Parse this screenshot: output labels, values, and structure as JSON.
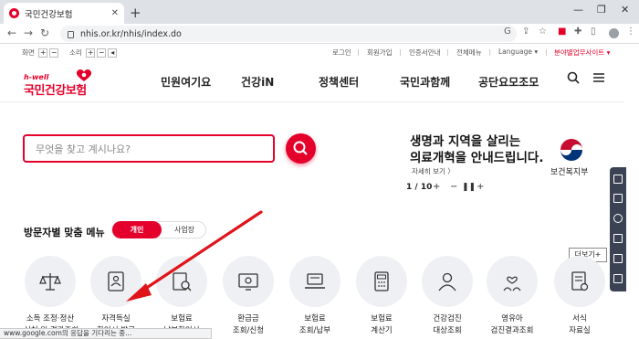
{
  "browser": {
    "tab_title": "국민건강보험",
    "tab_close": "✕",
    "new_tab": "+",
    "url": "nhis.or.kr/nhis/index.do",
    "minimize": "—",
    "restore": "❐",
    "close": "✕"
  },
  "util": {
    "zoom_label": "화면",
    "sound_label": "소리",
    "links": [
      "로그인",
      "회원가입",
      "인증서안내",
      "전체메뉴"
    ],
    "language": "Language ▾",
    "sites": "분야별업무사이트 ▾"
  },
  "logo": {
    "sub": "h-well",
    "main": "국민건강보험"
  },
  "gnb": [
    "민원여기요",
    "건강iN",
    "정책센터",
    "국민과함께",
    "공단요모조모"
  ],
  "search": {
    "placeholder": "무엇을 찾고 계시나요?"
  },
  "banner": {
    "line1": "생명과 지역을 살리는",
    "line2": "의료개혁을 안내드립니다.",
    "more": "자세히 보기 〉",
    "ministry": "보건복지부",
    "page": "1 / 10"
  },
  "section": {
    "title": "방문자별 맞춤 메뉴",
    "tab_personal": "개인",
    "tab_business": "사업장",
    "more": "더보기+"
  },
  "menu": [
    {
      "l1": "소득 조정·정산",
      "l2": "신청 및 결과조회"
    },
    {
      "l1": "자격득실",
      "l2": "확인서 발급"
    },
    {
      "l1": "보험료",
      "l2": "납부확인서"
    },
    {
      "l1": "환급금",
      "l2": "조회/신청"
    },
    {
      "l1": "보험료",
      "l2": "조회/납부"
    },
    {
      "l1": "보험료",
      "l2": "계산기"
    },
    {
      "l1": "건강검진",
      "l2": "대상조회"
    },
    {
      "l1": "영유아",
      "l2": "검진결과조회"
    },
    {
      "l1": "서식",
      "l2": "자료실"
    }
  ],
  "status": "www.google.com의 응답을 기다리는 중...",
  "colors": {
    "brand": "#e4002b",
    "quick_bar": "#3a4253",
    "arrow": "#e0141b"
  }
}
